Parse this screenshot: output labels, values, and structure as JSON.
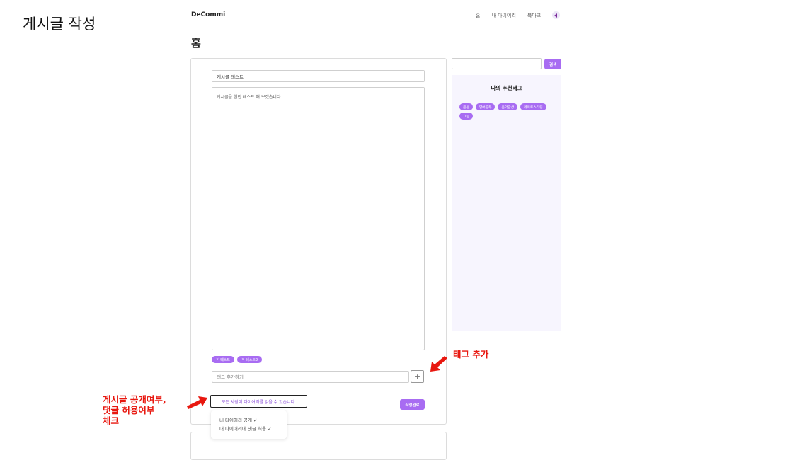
{
  "slide_title": "게시글 작성",
  "header": {
    "brand": "DeCommi",
    "nav": [
      "홈",
      "내 다이어리",
      "북마크"
    ]
  },
  "page_heading": "홈",
  "editor": {
    "title_value": "게시글 테스트",
    "content_value": "게시글을 한번 테스트 해 보겠습니다.",
    "tags": [
      "테스트",
      "테스트2"
    ],
    "tag_input_placeholder": "태그 추가하기",
    "tag_add_symbol": "+",
    "privacy_label": "모든 사람이 다이어리를 읽을 수 있습니다.",
    "submit_label": "작성완료",
    "dropdown_options": [
      "내 다이어리 공개 ✓",
      "내 다이어리에 댓글 허용 ✓"
    ]
  },
  "sidebar": {
    "search_button": "검색",
    "recommend_title": "나의 추천태그",
    "recommend_tags": [
      "운동",
      "영어공부",
      "음악감상",
      "레이트스타팅",
      "그림"
    ]
  },
  "annotations": {
    "tag_add": "태그 추가",
    "privacy_note": [
      "게시글 공개여부,",
      "댓글 허용여부",
      "체크"
    ]
  },
  "colors": {
    "accent": "#a86cf2",
    "annotation_red": "#e8170f"
  }
}
